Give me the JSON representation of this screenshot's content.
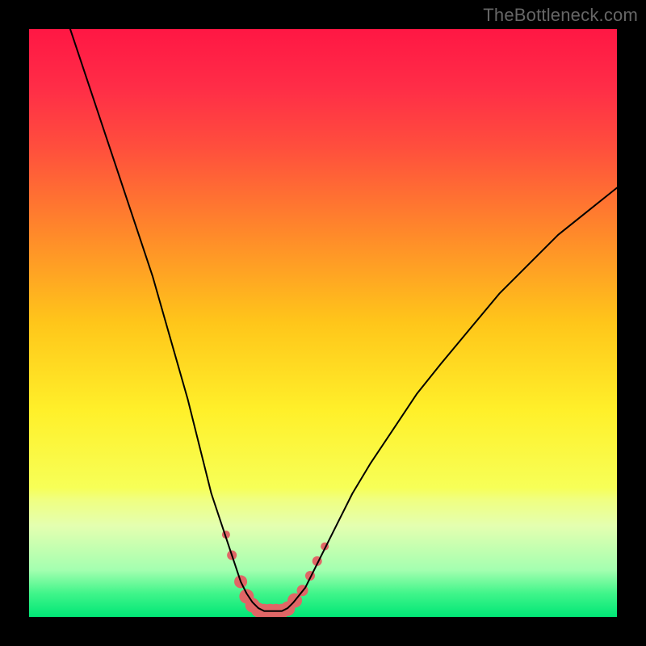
{
  "watermark": "TheBottleneck.com",
  "chart_data": {
    "type": "line",
    "title": "",
    "xlabel": "",
    "ylabel": "",
    "xlim": [
      0,
      100
    ],
    "ylim": [
      0,
      100
    ],
    "grid": false,
    "legend": false,
    "background": {
      "type": "vertical-gradient",
      "stops": [
        {
          "pos": 0.0,
          "color": "#ff1744"
        },
        {
          "pos": 0.1,
          "color": "#ff2d47"
        },
        {
          "pos": 0.2,
          "color": "#ff4e3d"
        },
        {
          "pos": 0.35,
          "color": "#ff8a2a"
        },
        {
          "pos": 0.5,
          "color": "#ffc61a"
        },
        {
          "pos": 0.65,
          "color": "#fff02a"
        },
        {
          "pos": 0.78,
          "color": "#f7ff57"
        },
        {
          "pos": 0.8,
          "color": "#f0ff80"
        },
        {
          "pos": 0.845,
          "color": "#e4ffb0"
        },
        {
          "pos": 0.92,
          "color": "#a4ffb0"
        },
        {
          "pos": 0.96,
          "color": "#40f58a"
        },
        {
          "pos": 1.0,
          "color": "#00e676"
        }
      ]
    },
    "series": [
      {
        "name": "bottleneck-curve",
        "stroke": "#000000",
        "stroke_width": 2,
        "x": [
          7,
          9,
          11,
          13,
          15,
          17,
          19,
          21,
          23,
          25,
          27,
          29,
          31,
          33,
          34,
          35,
          36,
          37,
          38,
          39,
          40,
          41,
          42,
          43,
          44,
          45,
          47,
          49,
          51,
          53,
          55,
          58,
          62,
          66,
          70,
          75,
          80,
          85,
          90,
          95,
          100
        ],
        "y": [
          100,
          94,
          88,
          82,
          76,
          70,
          64,
          58,
          51,
          44,
          37,
          29,
          21,
          15,
          12,
          9,
          6,
          4,
          2.5,
          1.5,
          1,
          1,
          1,
          1,
          1.5,
          2.5,
          5,
          9,
          13,
          17,
          21,
          26,
          32,
          38,
          43,
          49,
          55,
          60,
          65,
          69,
          73
        ]
      }
    ],
    "markers": {
      "color": "#e06666",
      "points": [
        {
          "x": 33.5,
          "y": 14.0,
          "r": 5
        },
        {
          "x": 34.5,
          "y": 10.5,
          "r": 6
        },
        {
          "x": 36.0,
          "y": 6.0,
          "r": 8
        },
        {
          "x": 37.0,
          "y": 3.5,
          "r": 9
        },
        {
          "x": 38.0,
          "y": 2.0,
          "r": 9
        },
        {
          "x": 39.0,
          "y": 1.2,
          "r": 9
        },
        {
          "x": 40.0,
          "y": 1.0,
          "r": 9
        },
        {
          "x": 41.0,
          "y": 1.0,
          "r": 9
        },
        {
          "x": 42.0,
          "y": 1.0,
          "r": 9
        },
        {
          "x": 43.0,
          "y": 1.0,
          "r": 9
        },
        {
          "x": 44.0,
          "y": 1.4,
          "r": 9
        },
        {
          "x": 45.2,
          "y": 2.8,
          "r": 9
        },
        {
          "x": 46.5,
          "y": 4.5,
          "r": 7
        },
        {
          "x": 47.8,
          "y": 7.0,
          "r": 6
        },
        {
          "x": 49.0,
          "y": 9.5,
          "r": 6
        },
        {
          "x": 50.3,
          "y": 12.0,
          "r": 5
        }
      ]
    }
  }
}
